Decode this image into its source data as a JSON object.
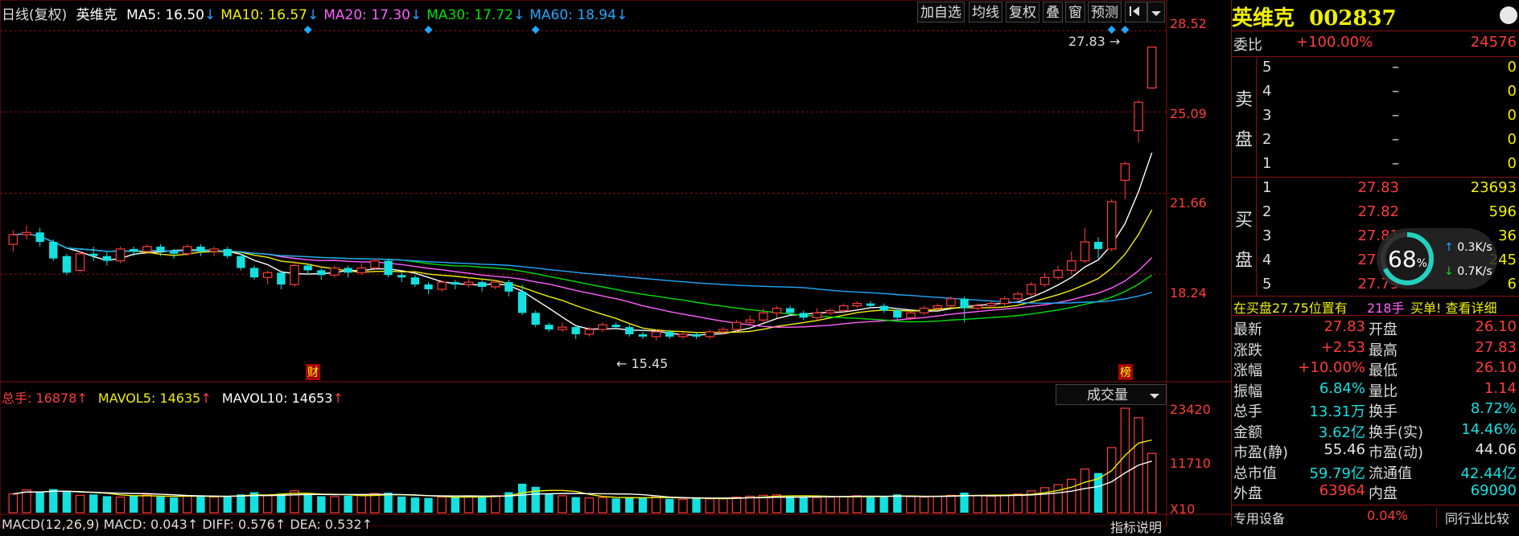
{
  "header": {
    "period": "日线(复权)",
    "name": "英维克",
    "ma": [
      {
        "label": "MA5: 16.50",
        "arrow": "↓",
        "color": "#ffffff"
      },
      {
        "label": "MA10: 16.57",
        "arrow": "↓",
        "color": "#f0f000"
      },
      {
        "label": "MA20: 17.30",
        "arrow": "↓",
        "color": "#ff60ff"
      },
      {
        "label": "MA30: 17.72",
        "arrow": "↓",
        "color": "#00e000"
      },
      {
        "label": "MA60: 18.94",
        "arrow": "↓",
        "color": "#20a8ff"
      }
    ]
  },
  "toolbar": {
    "add_watch": "加自选",
    "avg_line": "均线",
    "restore": "复权",
    "overlay": "叠",
    "window": "窗",
    "forecast": "预测",
    "expand_icon": "expand-icon",
    "dropdown_icon": "chevron-down-icon"
  },
  "price_axis": [
    "28.52",
    "25.09",
    "21.66",
    "18.24"
  ],
  "annotations": {
    "high": "27.83",
    "low": "15.45",
    "cai": "财",
    "bang": "榜"
  },
  "volume_header": {
    "total": "总手: 16878",
    "mavol5": "MAVOL5: 14635",
    "mavol10": "MAVOL10: 14653",
    "up_arrow": "↑",
    "selector": "成交量"
  },
  "volume_axis": [
    "23420",
    "11710",
    "X10"
  ],
  "macd_line": "MACD(12,26,9)  MACD: 0.043↑  DIFF: 0.576↑  DEA: 0.532↑",
  "indicator_help": "指标说明",
  "side": {
    "title": "英维克  002837",
    "weibi_label": "委比",
    "weibi_pct": "+100.00%",
    "weibi_num": "24576",
    "sell_label": [
      "卖",
      "盘"
    ],
    "buy_label": [
      "买",
      "盘"
    ],
    "sell": [
      {
        "n": "5",
        "p": "–",
        "v": "0"
      },
      {
        "n": "4",
        "p": "–",
        "v": "0"
      },
      {
        "n": "3",
        "p": "–",
        "v": "0"
      },
      {
        "n": "2",
        "p": "–",
        "v": "0"
      },
      {
        "n": "1",
        "p": "–",
        "v": "0"
      }
    ],
    "buy": [
      {
        "n": "1",
        "p": "27.83",
        "v": "23693"
      },
      {
        "n": "2",
        "p": "27.82",
        "v": "596"
      },
      {
        "n": "3",
        "p": "27.81",
        "v": "36"
      },
      {
        "n": "4",
        "p": "27.80",
        "v": "245"
      },
      {
        "n": "5",
        "p": "27.79",
        "v": "6"
      }
    ],
    "bid_note": "在买盘27.75位置有",
    "bid_hands": "218手",
    "bid_detail": "买单! 查看详细",
    "speed": {
      "pct": "68",
      "up": "0.3K/s",
      "down": "0.7K/s",
      "fill": 0.68
    },
    "stats": [
      {
        "l1": "最新",
        "v1": "27.83",
        "c1": "red",
        "l2": "开盘",
        "v2": "26.10",
        "c2": "red"
      },
      {
        "l1": "涨跌",
        "v1": "+2.53",
        "c1": "red",
        "l2": "最高",
        "v2": "27.83",
        "c2": "red"
      },
      {
        "l1": "涨幅",
        "v1": "+10.00%",
        "c1": "red",
        "l2": "最低",
        "v2": "26.10",
        "c2": "red"
      },
      {
        "l1": "振幅",
        "v1": "6.84%",
        "c1": "cyan",
        "l2": "量比",
        "v2": "1.14",
        "c2": "red"
      },
      {
        "l1": "总手",
        "v1": "13.31万",
        "c1": "cyan",
        "l2": "换手",
        "v2": "8.72%",
        "c2": "cyan"
      },
      {
        "l1": "金额",
        "v1": "3.62亿",
        "c1": "cyan",
        "l2": "换手(实)",
        "v2": "14.46%",
        "c2": "cyan"
      },
      {
        "l1": "市盈(静)",
        "v1": "55.46",
        "c1": "white",
        "l2": "市盈(动)",
        "v2": "44.06",
        "c2": "white"
      },
      {
        "l1": "总市值",
        "v1": "59.79亿",
        "c1": "cyan",
        "l2": "流通值",
        "v2": "42.44亿",
        "c2": "cyan"
      },
      {
        "l1": "外盘",
        "v1": "63964",
        "c1": "red",
        "l2": "内盘",
        "v2": "69090",
        "c2": "cyan"
      }
    ],
    "special": "专用设备",
    "special_pct": "0.04%",
    "compare": "同行业比较"
  },
  "chart_data": {
    "type": "candlestick",
    "ylim": [
      14.0,
      28.8
    ],
    "candles": [
      [
        19.5,
        19.9,
        19.2,
        20.1
      ],
      [
        19.9,
        20.0,
        19.7,
        20.3
      ],
      [
        20.0,
        19.6,
        19.4,
        20.2
      ],
      [
        19.6,
        18.9,
        18.8,
        19.7
      ],
      [
        19.0,
        18.3,
        18.2,
        19.1
      ],
      [
        18.4,
        19.1,
        18.3,
        19.2
      ],
      [
        19.1,
        19.0,
        18.8,
        19.4
      ],
      [
        19.0,
        18.8,
        18.6,
        19.2
      ],
      [
        18.8,
        19.3,
        18.7,
        19.4
      ],
      [
        19.3,
        19.2,
        19.0,
        19.4
      ],
      [
        19.2,
        19.4,
        19.1,
        19.5
      ],
      [
        19.4,
        19.2,
        19.0,
        19.5
      ],
      [
        19.2,
        19.1,
        18.9,
        19.3
      ],
      [
        19.1,
        19.4,
        19.0,
        19.5
      ],
      [
        19.4,
        19.2,
        19.0,
        19.5
      ],
      [
        19.2,
        19.3,
        19.0,
        19.4
      ],
      [
        19.3,
        19.0,
        18.9,
        19.4
      ],
      [
        19.0,
        18.5,
        18.4,
        19.1
      ],
      [
        18.5,
        18.1,
        18.0,
        18.6
      ],
      [
        18.1,
        18.3,
        17.8,
        18.4
      ],
      [
        18.3,
        17.8,
        17.6,
        18.4
      ],
      [
        17.8,
        18.6,
        17.7,
        18.8
      ],
      [
        18.6,
        18.4,
        18.2,
        18.7
      ],
      [
        18.4,
        18.2,
        18.0,
        18.5
      ],
      [
        18.2,
        18.5,
        18.1,
        18.6
      ],
      [
        18.5,
        18.3,
        18.1,
        18.6
      ],
      [
        18.3,
        18.5,
        18.2,
        18.7
      ],
      [
        18.5,
        18.8,
        18.4,
        18.9
      ],
      [
        18.8,
        18.2,
        18.1,
        18.9
      ],
      [
        18.2,
        18.1,
        17.9,
        18.3
      ],
      [
        18.1,
        17.8,
        17.7,
        18.2
      ],
      [
        17.8,
        17.6,
        17.4,
        17.9
      ],
      [
        17.6,
        17.9,
        17.5,
        18.0
      ],
      [
        17.9,
        17.8,
        17.6,
        18.0
      ],
      [
        17.8,
        17.9,
        17.7,
        18.1
      ],
      [
        17.9,
        17.7,
        17.5,
        18.0
      ],
      [
        17.7,
        17.9,
        17.6,
        18.0
      ],
      [
        17.9,
        17.5,
        17.3,
        18.0
      ],
      [
        17.5,
        16.6,
        16.5,
        17.8
      ],
      [
        16.6,
        16.1,
        16.0,
        16.7
      ],
      [
        16.1,
        15.9,
        15.8,
        16.2
      ],
      [
        15.9,
        16.0,
        15.8,
        16.2
      ],
      [
        16.0,
        15.7,
        15.5,
        16.1
      ],
      [
        15.7,
        15.9,
        15.6,
        16.0
      ],
      [
        15.9,
        16.1,
        15.8,
        16.2
      ],
      [
        16.1,
        16.0,
        15.9,
        16.2
      ],
      [
        16.0,
        15.7,
        15.6,
        16.1
      ],
      [
        15.7,
        15.6,
        15.5,
        15.8
      ],
      [
        15.6,
        15.8,
        15.45,
        15.9
      ],
      [
        15.8,
        15.6,
        15.5,
        15.9
      ],
      [
        15.6,
        15.7,
        15.5,
        15.8
      ],
      [
        15.7,
        15.6,
        15.5,
        15.8
      ],
      [
        15.6,
        15.8,
        15.5,
        15.9
      ],
      [
        15.8,
        15.9,
        15.7,
        16.0
      ],
      [
        15.9,
        16.2,
        15.8,
        16.3
      ],
      [
        16.2,
        16.3,
        16.1,
        16.5
      ],
      [
        16.3,
        16.6,
        16.2,
        16.8
      ],
      [
        16.6,
        16.8,
        16.4,
        16.9
      ],
      [
        16.8,
        16.6,
        16.5,
        16.9
      ],
      [
        16.6,
        16.4,
        16.3,
        16.7
      ],
      [
        16.4,
        16.6,
        16.3,
        16.8
      ],
      [
        16.6,
        16.7,
        16.5,
        16.8
      ],
      [
        16.7,
        16.9,
        16.6,
        17.0
      ],
      [
        16.9,
        17.0,
        16.8,
        17.1
      ],
      [
        17.0,
        16.9,
        16.8,
        17.1
      ],
      [
        16.9,
        16.7,
        16.6,
        17.0
      ],
      [
        16.7,
        16.4,
        16.3,
        16.8
      ],
      [
        16.4,
        16.6,
        16.3,
        16.7
      ],
      [
        16.6,
        16.8,
        16.5,
        16.9
      ],
      [
        16.8,
        16.9,
        16.7,
        17.0
      ],
      [
        16.9,
        17.2,
        16.8,
        17.3
      ],
      [
        17.2,
        16.8,
        16.2,
        17.3
      ],
      [
        16.8,
        16.9,
        16.7,
        17.0
      ],
      [
        16.9,
        17.0,
        16.8,
        17.1
      ],
      [
        17.0,
        17.2,
        16.9,
        17.3
      ],
      [
        17.2,
        17.4,
        17.1,
        17.5
      ],
      [
        17.4,
        17.8,
        17.3,
        17.9
      ],
      [
        17.8,
        18.1,
        17.7,
        18.3
      ],
      [
        18.1,
        18.4,
        18.0,
        18.6
      ],
      [
        18.4,
        18.8,
        18.2,
        19.2
      ],
      [
        18.8,
        19.6,
        18.7,
        20.2
      ],
      [
        19.6,
        19.3,
        18.9,
        19.8
      ],
      [
        19.3,
        21.3,
        19.2,
        21.4
      ],
      [
        22.2,
        22.9,
        21.4,
        23.0
      ],
      [
        24.3,
        25.5,
        23.8,
        25.6
      ],
      [
        26.1,
        27.83,
        26.1,
        27.83
      ]
    ],
    "volume": [
      4200,
      5100,
      4600,
      5300,
      4800,
      3900,
      4100,
      3700,
      3500,
      3800,
      4000,
      3600,
      3400,
      3700,
      3900,
      3500,
      3800,
      4100,
      4600,
      3900,
      4300,
      4900,
      4100,
      3700,
      3600,
      3800,
      3900,
      4300,
      4500,
      3600,
      3400,
      3300,
      3500,
      3600,
      3700,
      3500,
      3800,
      4600,
      6500,
      5800,
      4200,
      3800,
      3500,
      3300,
      3400,
      3200,
      3500,
      3300,
      3700,
      3100,
      3000,
      3200,
      3100,
      3300,
      3500,
      3700,
      3900,
      4000,
      3800,
      3600,
      3400,
      3500,
      3600,
      3800,
      3700,
      3500,
      4100,
      3600,
      3500,
      3700,
      3900,
      4500,
      3800,
      3700,
      3900,
      4200,
      4900,
      5600,
      6300,
      7500,
      9800,
      8900,
      14600,
      23420,
      21300,
      13300
    ]
  }
}
